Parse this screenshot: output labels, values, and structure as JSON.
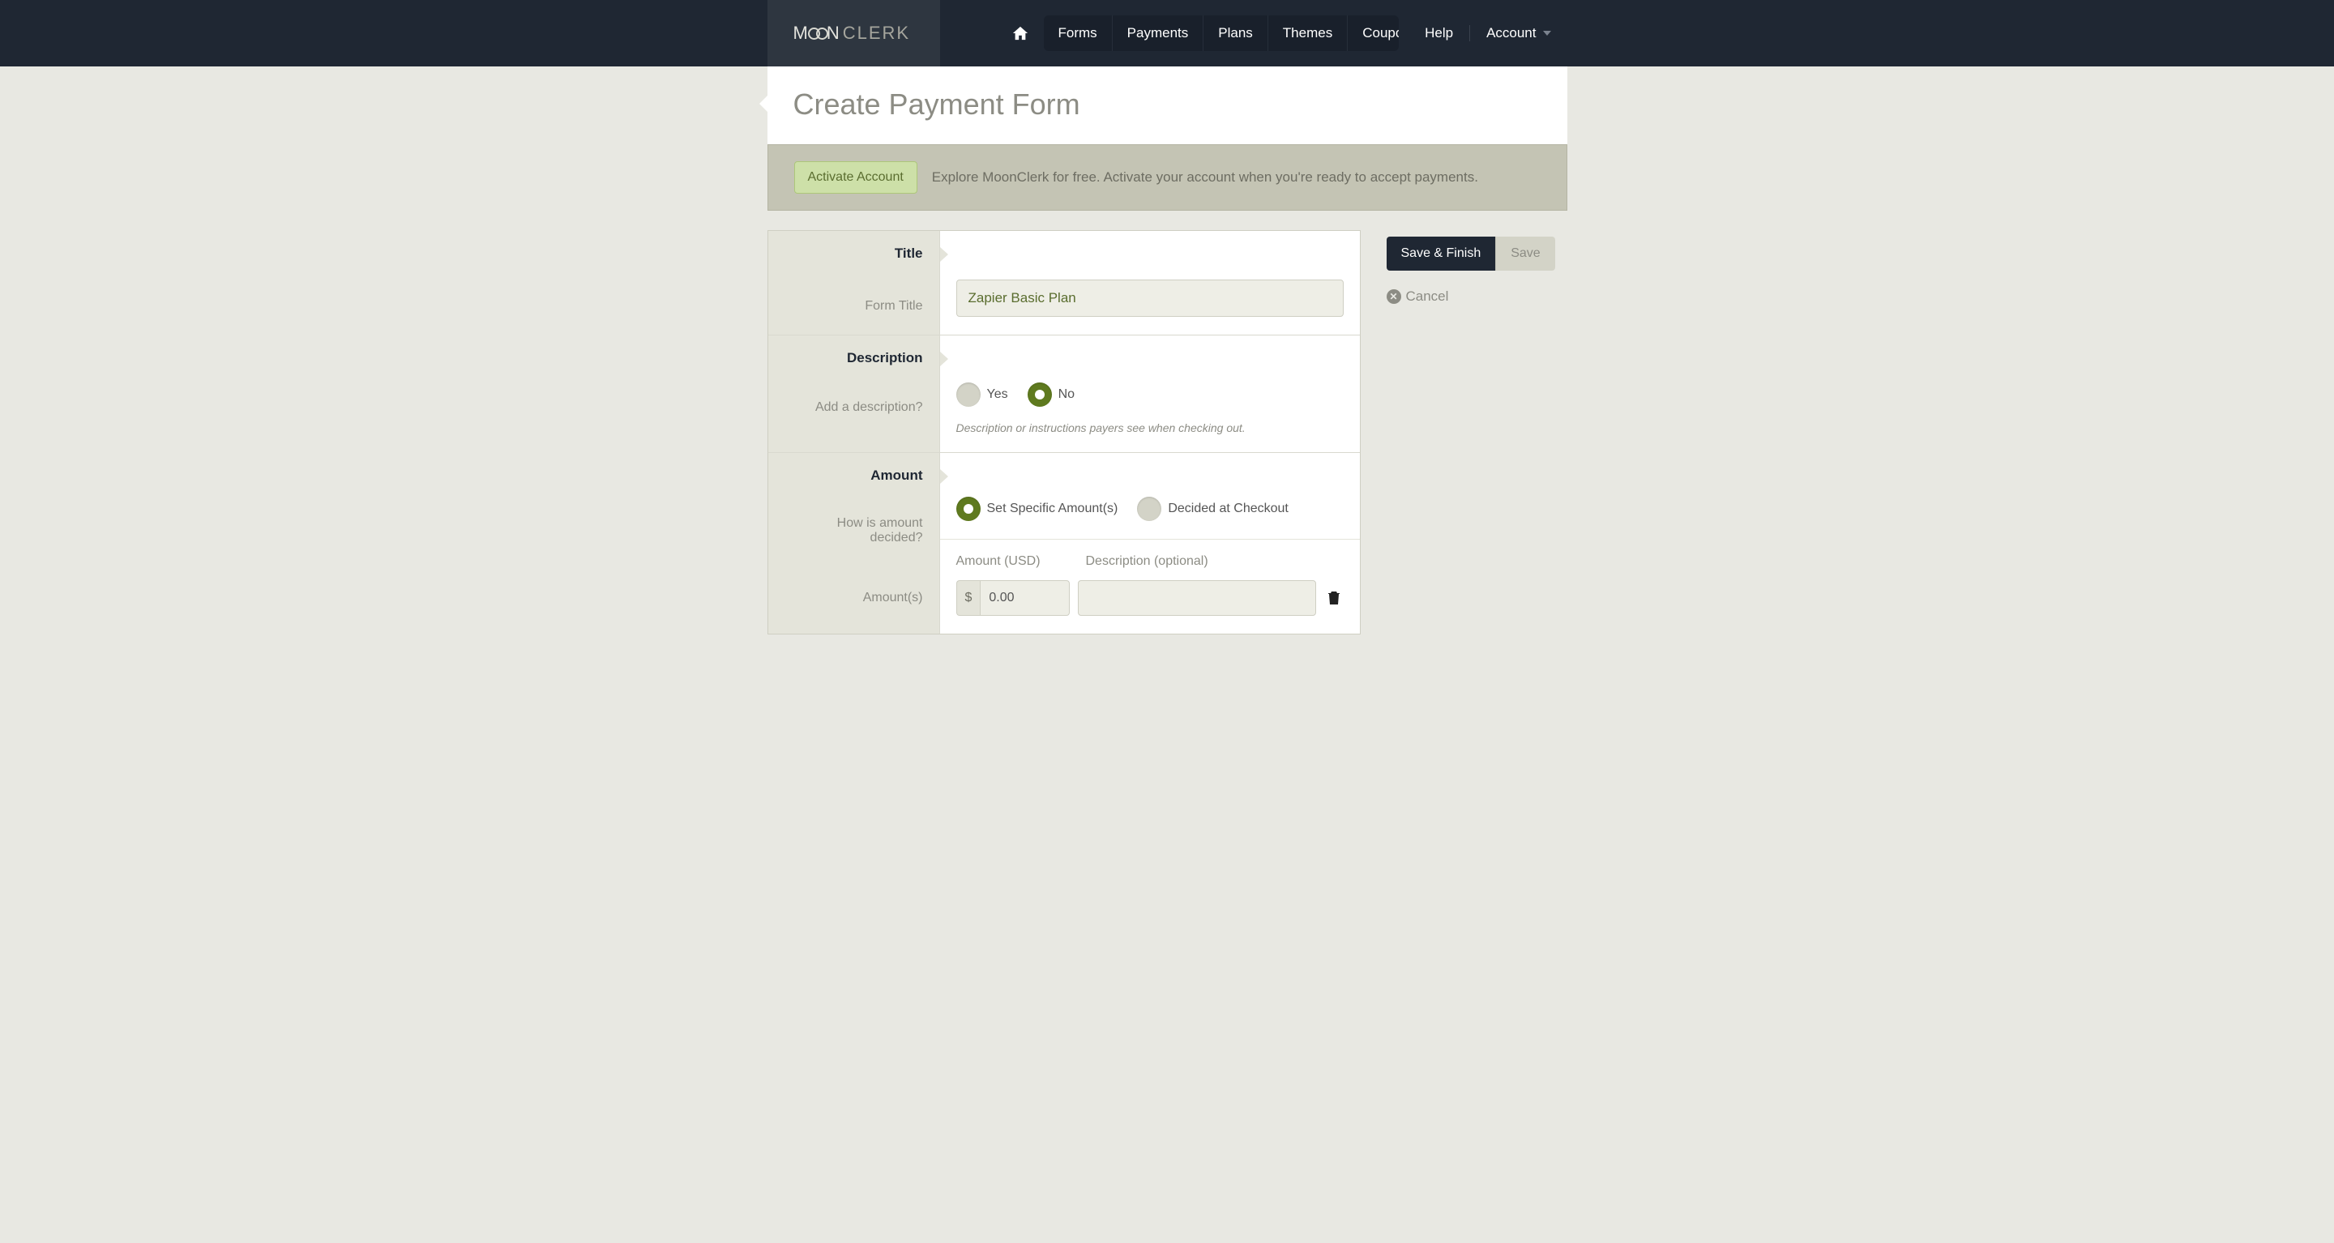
{
  "nav": {
    "items": [
      "Forms",
      "Payments",
      "Plans",
      "Themes",
      "Coupons"
    ],
    "help": "Help",
    "account": "Account"
  },
  "page": {
    "title": "Create Payment Form"
  },
  "activation": {
    "button": "Activate Account",
    "text": "Explore MoonClerk for free. Activate your account when you're ready to accept payments."
  },
  "sections": {
    "title": {
      "heading": "Title",
      "label": "Form Title",
      "value": "Zapier Basic Plan"
    },
    "description": {
      "heading": "Description",
      "label": "Add a description?",
      "options": {
        "yes": "Yes",
        "no": "No"
      },
      "selected": "no",
      "helper": "Description or instructions payers see when checking out."
    },
    "amount": {
      "heading": "Amount",
      "decided_label": "How is amount decided?",
      "options": {
        "specific": "Set Specific Amount(s)",
        "checkout": "Decided at Checkout"
      },
      "selected": "specific",
      "amounts_label": "Amount(s)",
      "columns": {
        "amount": "Amount (USD)",
        "description": "Description (optional)"
      },
      "currency_symbol": "$",
      "rows": [
        {
          "amount": "0.00",
          "description": ""
        }
      ]
    }
  },
  "side": {
    "save_finish": "Save & Finish",
    "save": "Save",
    "cancel": "Cancel"
  }
}
